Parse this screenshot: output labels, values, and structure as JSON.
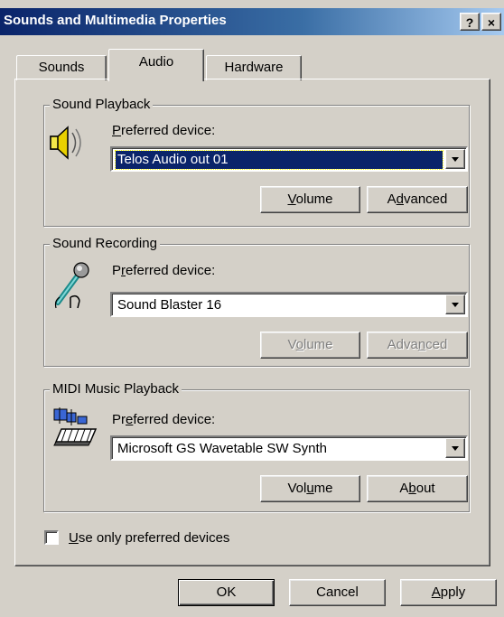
{
  "window": {
    "title": "Sounds and Multimedia Properties",
    "help_label": "?",
    "close_label": "×"
  },
  "tabs": [
    {
      "label": "Sounds",
      "active": false
    },
    {
      "label": "Audio",
      "active": true
    },
    {
      "label": "Hardware",
      "active": false
    }
  ],
  "playback": {
    "group_label": "Sound Playback",
    "pref_label_u": "P",
    "pref_label_rest": "referred device:",
    "device": "Telos Audio out 01",
    "volume_u": "V",
    "volume_rest": "olume",
    "advanced_pre": "A",
    "advanced_u": "d",
    "advanced_rest": "vanced",
    "icon": "speaker-icon"
  },
  "recording": {
    "group_label": "Sound Recording",
    "pref_label_pre": "P",
    "pref_label_u": "r",
    "pref_label_rest": "eferred device:",
    "device": "Sound Blaster 16",
    "volume_pre": "V",
    "volume_u": "o",
    "volume_rest": "lume",
    "advanced_pre": "Adva",
    "advanced_u": "n",
    "advanced_rest": "ced",
    "icon": "microphone-icon"
  },
  "midi": {
    "group_label": "MIDI Music Playback",
    "pref_label_pre": "Pr",
    "pref_label_u": "e",
    "pref_label_rest": "ferred device:",
    "device": "Microsoft GS Wavetable SW Synth",
    "volume_pre": "Vol",
    "volume_u": "u",
    "volume_rest": "me",
    "about_pre": "A",
    "about_u": "b",
    "about_rest": "out",
    "icon": "midi-keyboard-icon"
  },
  "preferred_only": {
    "label_u": "U",
    "label_rest": "se only preferred devices",
    "checked": false
  },
  "footer": {
    "ok": "OK",
    "cancel": "Cancel",
    "apply_u": "A",
    "apply_rest": "pply"
  }
}
